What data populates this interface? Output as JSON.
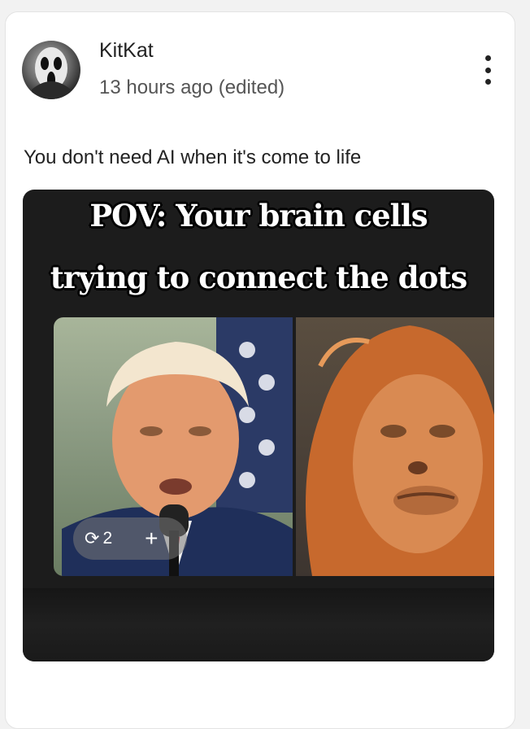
{
  "post": {
    "username": "KitKat",
    "timestamp": "13 hours ago (edited)",
    "text": "You don't need AI when it's come to life",
    "more_icon": "more-vertical-icon",
    "avatar_icon": "scream-mask-avatar"
  },
  "media": {
    "caption_line1": "POV: Your brain cells",
    "caption_line2": "trying to connect the dots",
    "repost_count": "2",
    "repost_icon": "repost-icon",
    "add_icon": "plus-icon"
  }
}
